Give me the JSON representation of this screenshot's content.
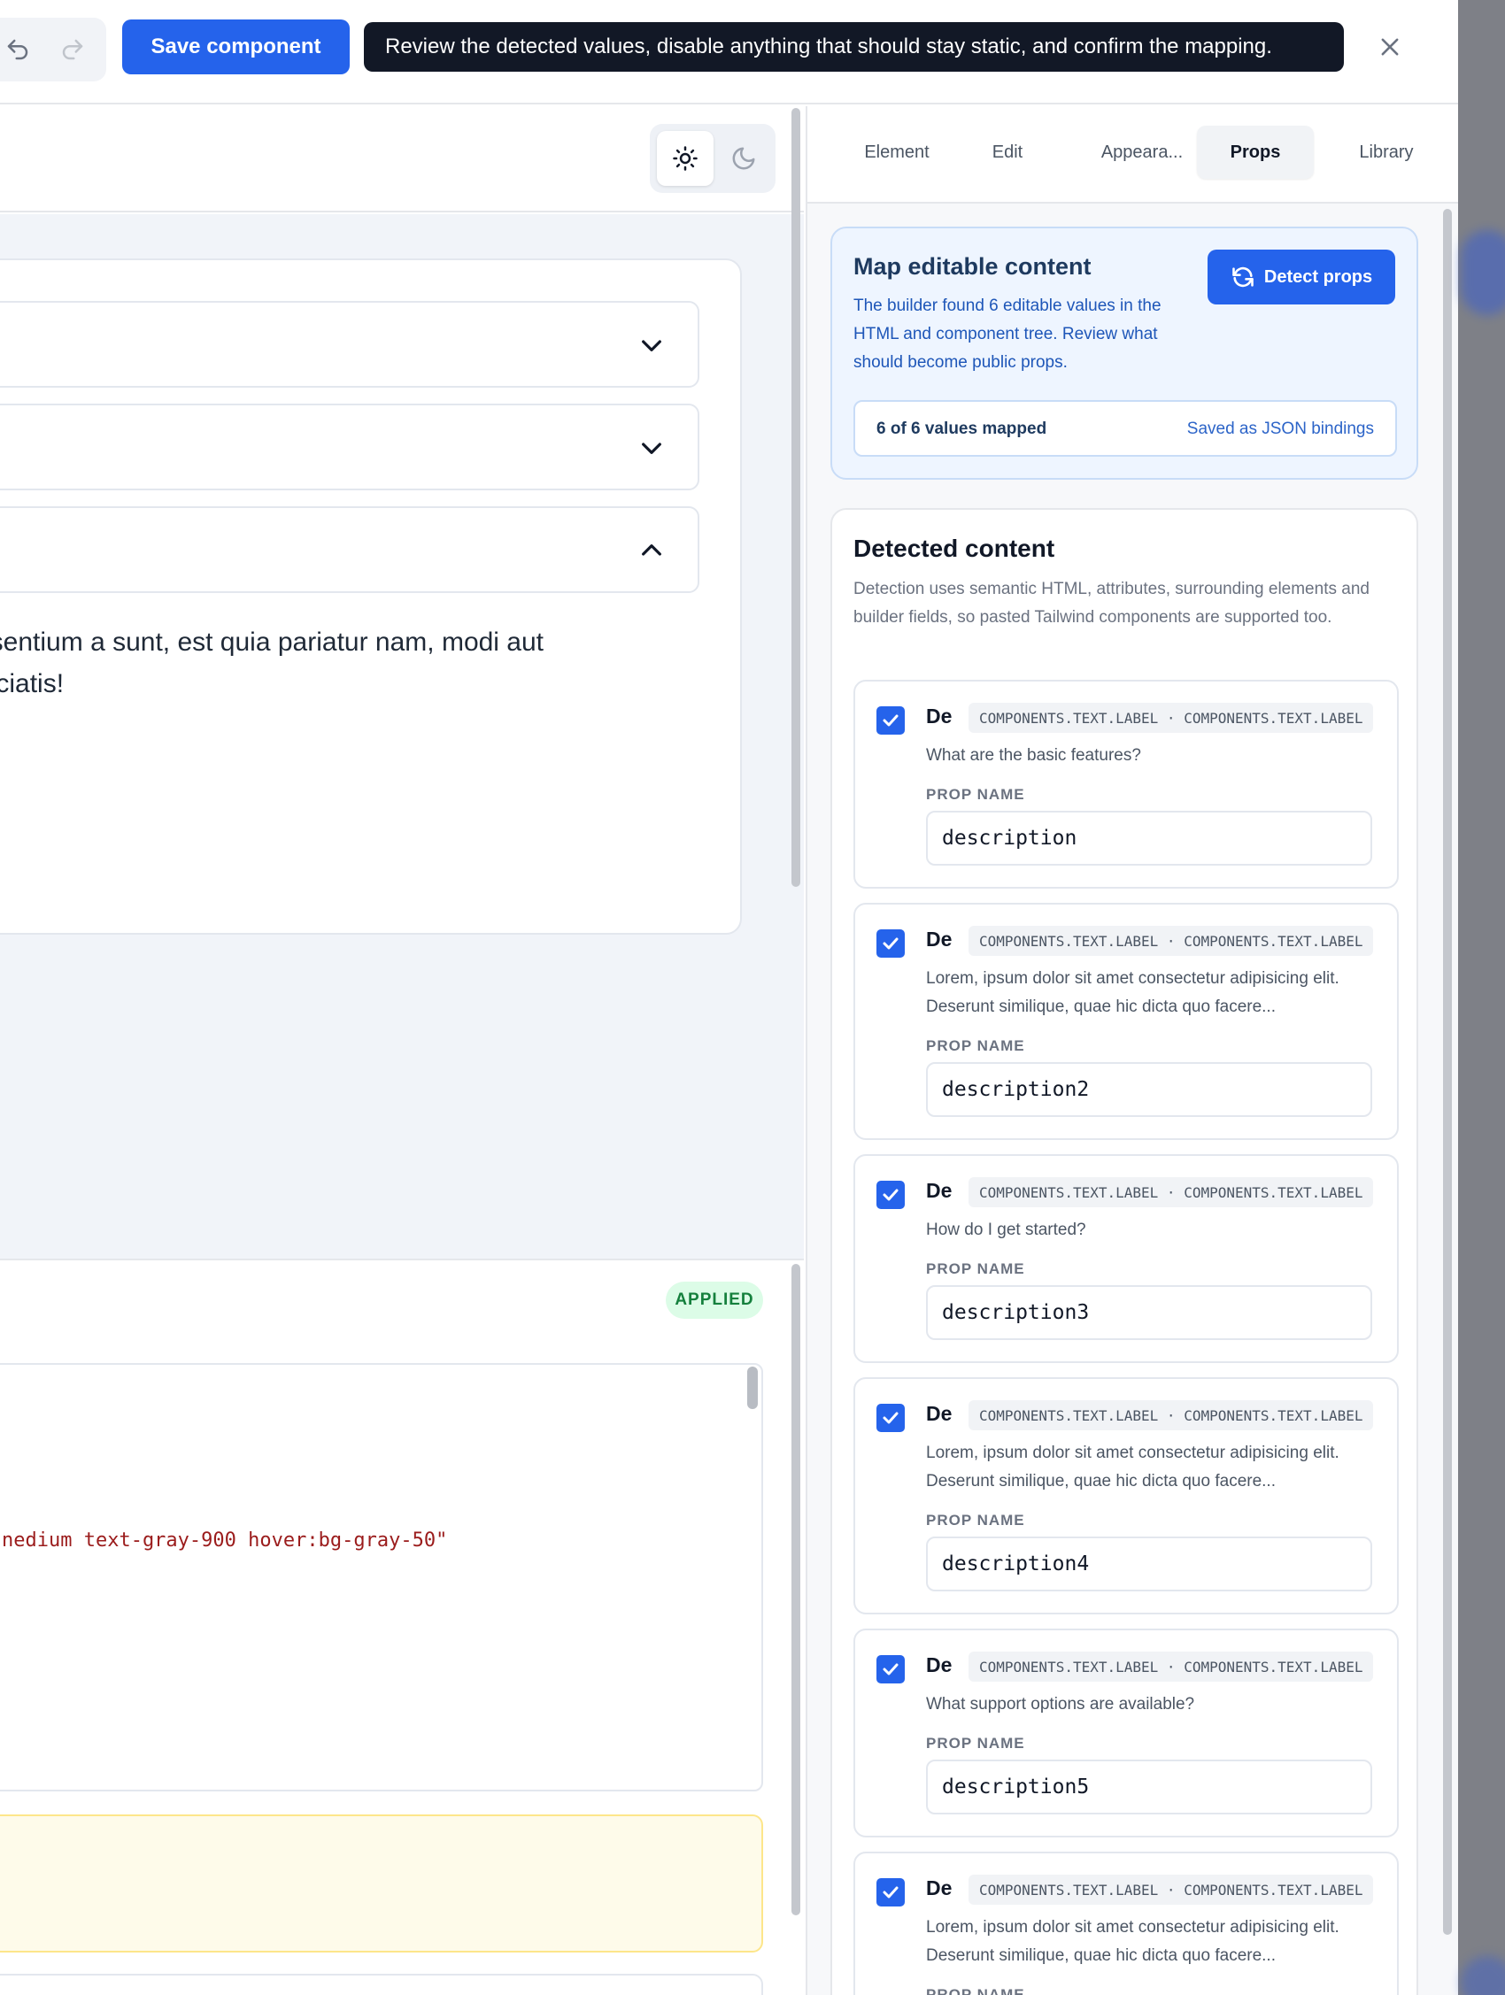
{
  "toolbar": {
    "undo_icon": "undo-icon",
    "redo_icon": "redo-icon",
    "save_label": "Save component",
    "hint": "Review the detected values, disable anything that should stay static, and confirm the mapping.",
    "close_icon": "close-icon"
  },
  "preview": {
    "accordion_body": "esentium a sunt, est quia pariatur nam, modi aut\npiciatis!",
    "code_line": "nedium text-gray-900 hover:bg-gray-50\"",
    "applied_badge": "APPLIED"
  },
  "tabs": [
    {
      "label": "Element"
    },
    {
      "label": "Edit"
    },
    {
      "label": "Appeara..."
    },
    {
      "label": "Props",
      "active": true
    },
    {
      "label": "Library"
    }
  ],
  "map": {
    "title": "Map editable content",
    "description": "The builder found 6 editable values in the HTML and component tree. Review what should become public props.",
    "detect_label": "Detect props",
    "mapped_count": "6 of 6 values mapped",
    "saved_as": "Saved as JSON bindings"
  },
  "detected": {
    "title": "Detected content",
    "description": "Detection uses semantic HTML, attributes, surrounding elements and builder fields, so pasted Tailwind components are supported too.",
    "prop_name_label": "PROP NAME",
    "items": [
      {
        "checked": true,
        "tag": "De",
        "path": "COMPONENTS.TEXT.LABEL · COMPONENTS.TEXT.LABEL",
        "value": "What are the basic features?",
        "prop": "description"
      },
      {
        "checked": true,
        "tag": "De",
        "path": "COMPONENTS.TEXT.LABEL · COMPONENTS.TEXT.LABEL",
        "value": "Lorem, ipsum dolor sit amet consectetur adipisicing elit. Deserunt similique, quae hic dicta quo facere...",
        "prop": "description2"
      },
      {
        "checked": true,
        "tag": "De",
        "path": "COMPONENTS.TEXT.LABEL · COMPONENTS.TEXT.LABEL",
        "value": "How do I get started?",
        "prop": "description3"
      },
      {
        "checked": true,
        "tag": "De",
        "path": "COMPONENTS.TEXT.LABEL · COMPONENTS.TEXT.LABEL",
        "value": "Lorem, ipsum dolor sit amet consectetur adipisicing elit. Deserunt similique, quae hic dicta quo facere...",
        "prop": "description4"
      },
      {
        "checked": true,
        "tag": "De",
        "path": "COMPONENTS.TEXT.LABEL · COMPONENTS.TEXT.LABEL",
        "value": "What support options are available?",
        "prop": "description5"
      },
      {
        "checked": true,
        "tag": "De",
        "path": "COMPONENTS.TEXT.LABEL · COMPONENTS.TEXT.LABEL",
        "value": "Lorem, ipsum dolor sit amet consectetur adipisicing elit. Deserunt similique, quae hic dicta quo facere...",
        "prop_label_only": true
      }
    ]
  },
  "colors": {
    "accent": "#2563eb",
    "hint_bg": "#121826",
    "applied_bg": "#dcfce7",
    "applied_text": "#15803d"
  }
}
